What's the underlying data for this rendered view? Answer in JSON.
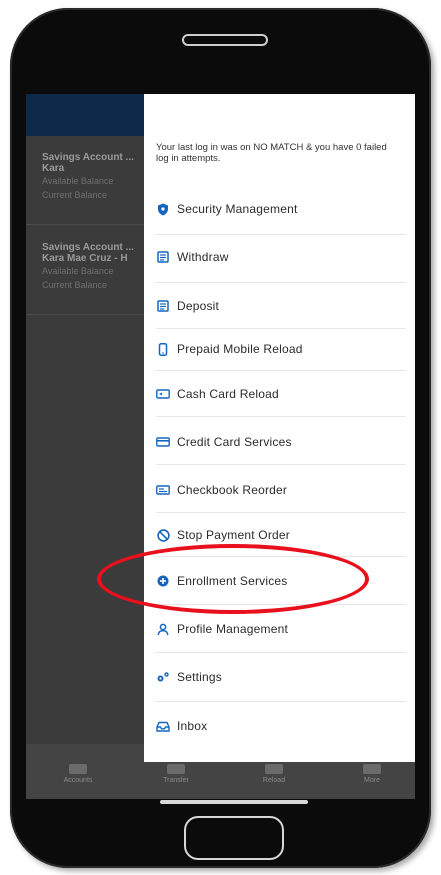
{
  "colors": {
    "accent": "#1565c0",
    "highlight": "#e8101c",
    "header": "#0d2a4a"
  },
  "drawer": {
    "last_login_text": "Your last log in was on NO MATCH & you have 0 failed log in attempts.",
    "items": [
      {
        "label": "Security Management",
        "icon": "shield-icon"
      },
      {
        "label": "Withdraw",
        "icon": "check-doc-icon"
      },
      {
        "label": "Deposit",
        "icon": "check-doc-icon"
      },
      {
        "label": "Prepaid Mobile Reload",
        "icon": "mobile-phone-icon"
      },
      {
        "label": "Cash Card Reload",
        "icon": "cash-card-icon"
      },
      {
        "label": "Credit Card Services",
        "icon": "credit-card-icon"
      },
      {
        "label": "Checkbook Reorder",
        "icon": "checkbook-icon"
      },
      {
        "label": "Stop Payment Order",
        "icon": "prohibited-icon"
      },
      {
        "label": "Enrollment Services",
        "icon": "plus-circle-icon"
      },
      {
        "label": "Profile Management",
        "icon": "person-icon"
      },
      {
        "label": "Settings",
        "icon": "gears-icon"
      },
      {
        "label": "Inbox",
        "icon": "inbox-icon"
      }
    ]
  },
  "background": {
    "accounts": [
      {
        "title": "Savings Account ...",
        "name": "Kara",
        "line1": "Available Balance",
        "line2": "Current Balance"
      },
      {
        "title": "Savings Account ...",
        "name": "Kara Mae Cruz - H",
        "line1": "Available Balance",
        "line2": "Current Balance"
      }
    ],
    "tabs": [
      {
        "label": "Accounts"
      },
      {
        "label": "Transfer"
      },
      {
        "label": "Reload"
      },
      {
        "label": "More"
      }
    ]
  }
}
